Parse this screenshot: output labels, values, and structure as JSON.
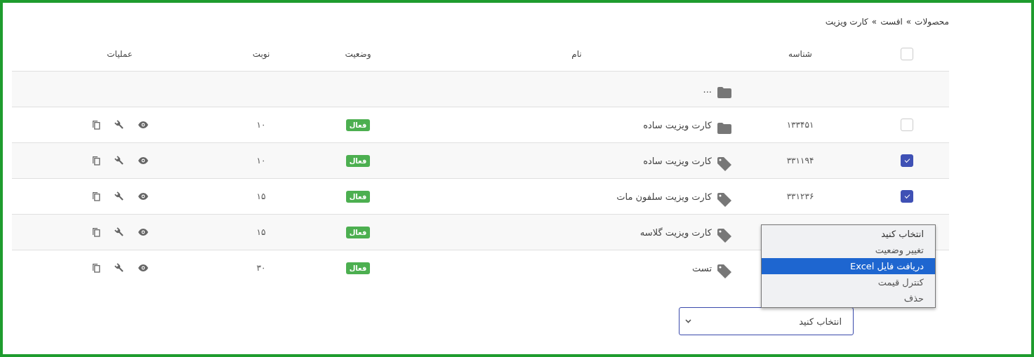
{
  "breadcrumb": {
    "items": [
      "محصولات",
      "افست",
      "کارت ویزیت"
    ],
    "separator": "»"
  },
  "table": {
    "header_checked": false,
    "columns": [
      "شناسه",
      "نام",
      "وضعیت",
      "نوبت",
      "عملیات"
    ],
    "rows": [
      {
        "kind": "folder",
        "name": "..."
      },
      {
        "kind": "folder",
        "checked": false,
        "id": "۱۳۳۴۵۱",
        "name": "کارت ویزیت ساده",
        "status": "فعال",
        "turn": "۱۰"
      },
      {
        "kind": "product",
        "checked": true,
        "id": "۳۳۱۱۹۴",
        "name": "کارت ویزیت ساده",
        "status": "فعال",
        "turn": "۱۰"
      },
      {
        "kind": "product",
        "checked": true,
        "id": "۳۳۱۲۳۶",
        "name": "کارت ویزیت سلفون مات",
        "status": "فعال",
        "turn": "۱۵"
      },
      {
        "kind": "product",
        "name": "کارت ویزیت گلاسه",
        "status": "فعال",
        "turn": "۱۵"
      },
      {
        "kind": "product",
        "name": "تست",
        "status": "فعال",
        "turn": "۳۰"
      }
    ]
  },
  "bulk_action": {
    "value": "انتخاب کنید",
    "expanded": true,
    "options": [
      {
        "label": "انتخاب کنید",
        "selected": true,
        "highlighted": false
      },
      {
        "label": "تغییر وضعیت",
        "selected": false,
        "highlighted": false
      },
      {
        "label": "دریافت فایل Excel",
        "selected": false,
        "highlighted": true
      },
      {
        "label": "کنترل قیمت",
        "selected": false,
        "highlighted": false
      },
      {
        "label": "حذف",
        "selected": false,
        "highlighted": false
      }
    ]
  }
}
